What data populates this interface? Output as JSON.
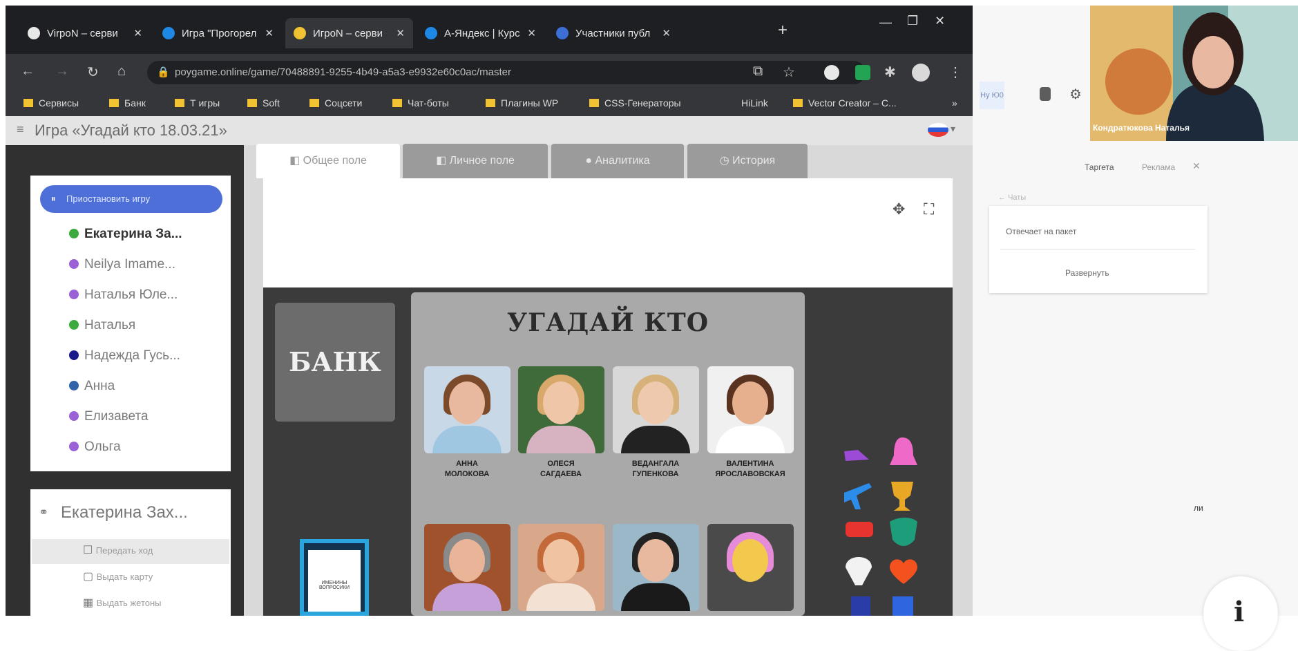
{
  "browser": {
    "tabs": [
      {
        "title": "VirpoN – серви",
        "color": "#e8e8e8",
        "active": false
      },
      {
        "title": "Игра \"Прогорел",
        "color": "#1e88e5",
        "active": false
      },
      {
        "title": "ИгроN – серви",
        "color": "#f1c232",
        "active": true
      },
      {
        "title": "A-Яндекс | Курс",
        "color": "#1e88e5",
        "active": false
      },
      {
        "title": "Участники публ",
        "color": "#3b6fd6",
        "active": false
      }
    ],
    "new_tab": "+",
    "window_controls": {
      "minimize": "—",
      "maximize": "❐",
      "close": "✕"
    },
    "url": "poygame.online/game/70488891-9255-4b49-a5a3-e9932e60c0ac/master",
    "bookmarks": [
      "Сервисы",
      "Банк",
      "Т игры",
      "Soft",
      "Соцсети",
      "Чат-боты",
      "Плагины WP",
      "CSS-Генераторы",
      "HiLink",
      "Vector Creator – C..."
    ],
    "bookmarks_more": "»"
  },
  "app": {
    "title": "Игра «Угадай кто 18.03.21»",
    "language_flag": "ru-flag-icon",
    "pause_button": "Приостановить игру",
    "players": [
      {
        "name": "Екатерина За...",
        "color": "#3caa3c",
        "bold": true
      },
      {
        "name": "Neilya Imame...",
        "color": "#9a62d6",
        "bold": false
      },
      {
        "name": "Наталья Юле...",
        "color": "#9a62d6",
        "bold": false
      },
      {
        "name": "Наталья",
        "color": "#3caa3c",
        "bold": false
      },
      {
        "name": "Надежда Гусь...",
        "color": "#1b1b8a",
        "bold": false
      },
      {
        "name": "Анна",
        "color": "#2f65a8",
        "bold": false
      },
      {
        "name": "Елизавета",
        "color": "#9a62d6",
        "bold": false
      },
      {
        "name": "Ольга",
        "color": "#9a62d6",
        "bold": false
      }
    ],
    "selected_player": "Екатерина Зах...",
    "player_actions": [
      "Передать ход",
      "Выдать карту",
      "Выдать жетоны"
    ],
    "tabs": [
      "Общее поле",
      "Личное поле",
      "Аналитика",
      "История"
    ],
    "board": {
      "bank_label": "БАНК",
      "game_title": "УГАДАЙ КТО",
      "people": [
        {
          "name": "АННА\nМОЛОКОВА",
          "skin": "#e8b99e",
          "hair": "#7a4a2a",
          "bg": "#c9d8e6",
          "shirt": "#9fc7e2"
        },
        {
          "name": "ОЛЕСЯ\nСАГДАЕВА",
          "skin": "#efc6a8",
          "hair": "#d9a86b",
          "bg": "#3f6a3a",
          "shirt": "#d7b3c2"
        },
        {
          "name": "ВЕДАНГАЛА\nГУПЕНКОВА",
          "skin": "#eec9ad",
          "hair": "#d6b27a",
          "bg": "#d8d8d8",
          "shirt": "#222222"
        },
        {
          "name": "ВАЛЕНТИНА\nЯРОСЛАВОВСКАЯ",
          "skin": "#e6b08f",
          "hair": "#5a3220",
          "bg": "#f0f0f0",
          "shirt": "#ffffff"
        },
        {
          "name": "",
          "skin": "#e9b497",
          "hair": "#8a8a8a",
          "bg": "#a0522d",
          "shirt": "#c6a0d8"
        },
        {
          "name": "",
          "skin": "#f0c4a2",
          "hair": "#c46a3a",
          "bg": "#d9a78a",
          "shirt": "#f3e2d3"
        },
        {
          "name": "",
          "skin": "#e8b99e",
          "hair": "#222222",
          "bg": "#9bb8c8",
          "shirt": "#1a1a1a"
        },
        {
          "name": "",
          "skin": "#f2c94c",
          "hair": "#e68bd8",
          "bg": "#4a4a4a",
          "shirt": "#4a4a4a"
        }
      ],
      "card_text": "ИМЕНИНЫ\nВОПРОСИКИ"
    }
  },
  "meet": {
    "participant_name": "Кондратюкова Наталья",
    "chat_tabs": [
      "Таргета",
      "Реклама"
    ],
    "dropdown_value": "Чаты",
    "popup_text": "Отвечает на пакет",
    "popup_button": "Развернуть",
    "side_label": "ли",
    "search_label": "Ну Ю0"
  }
}
